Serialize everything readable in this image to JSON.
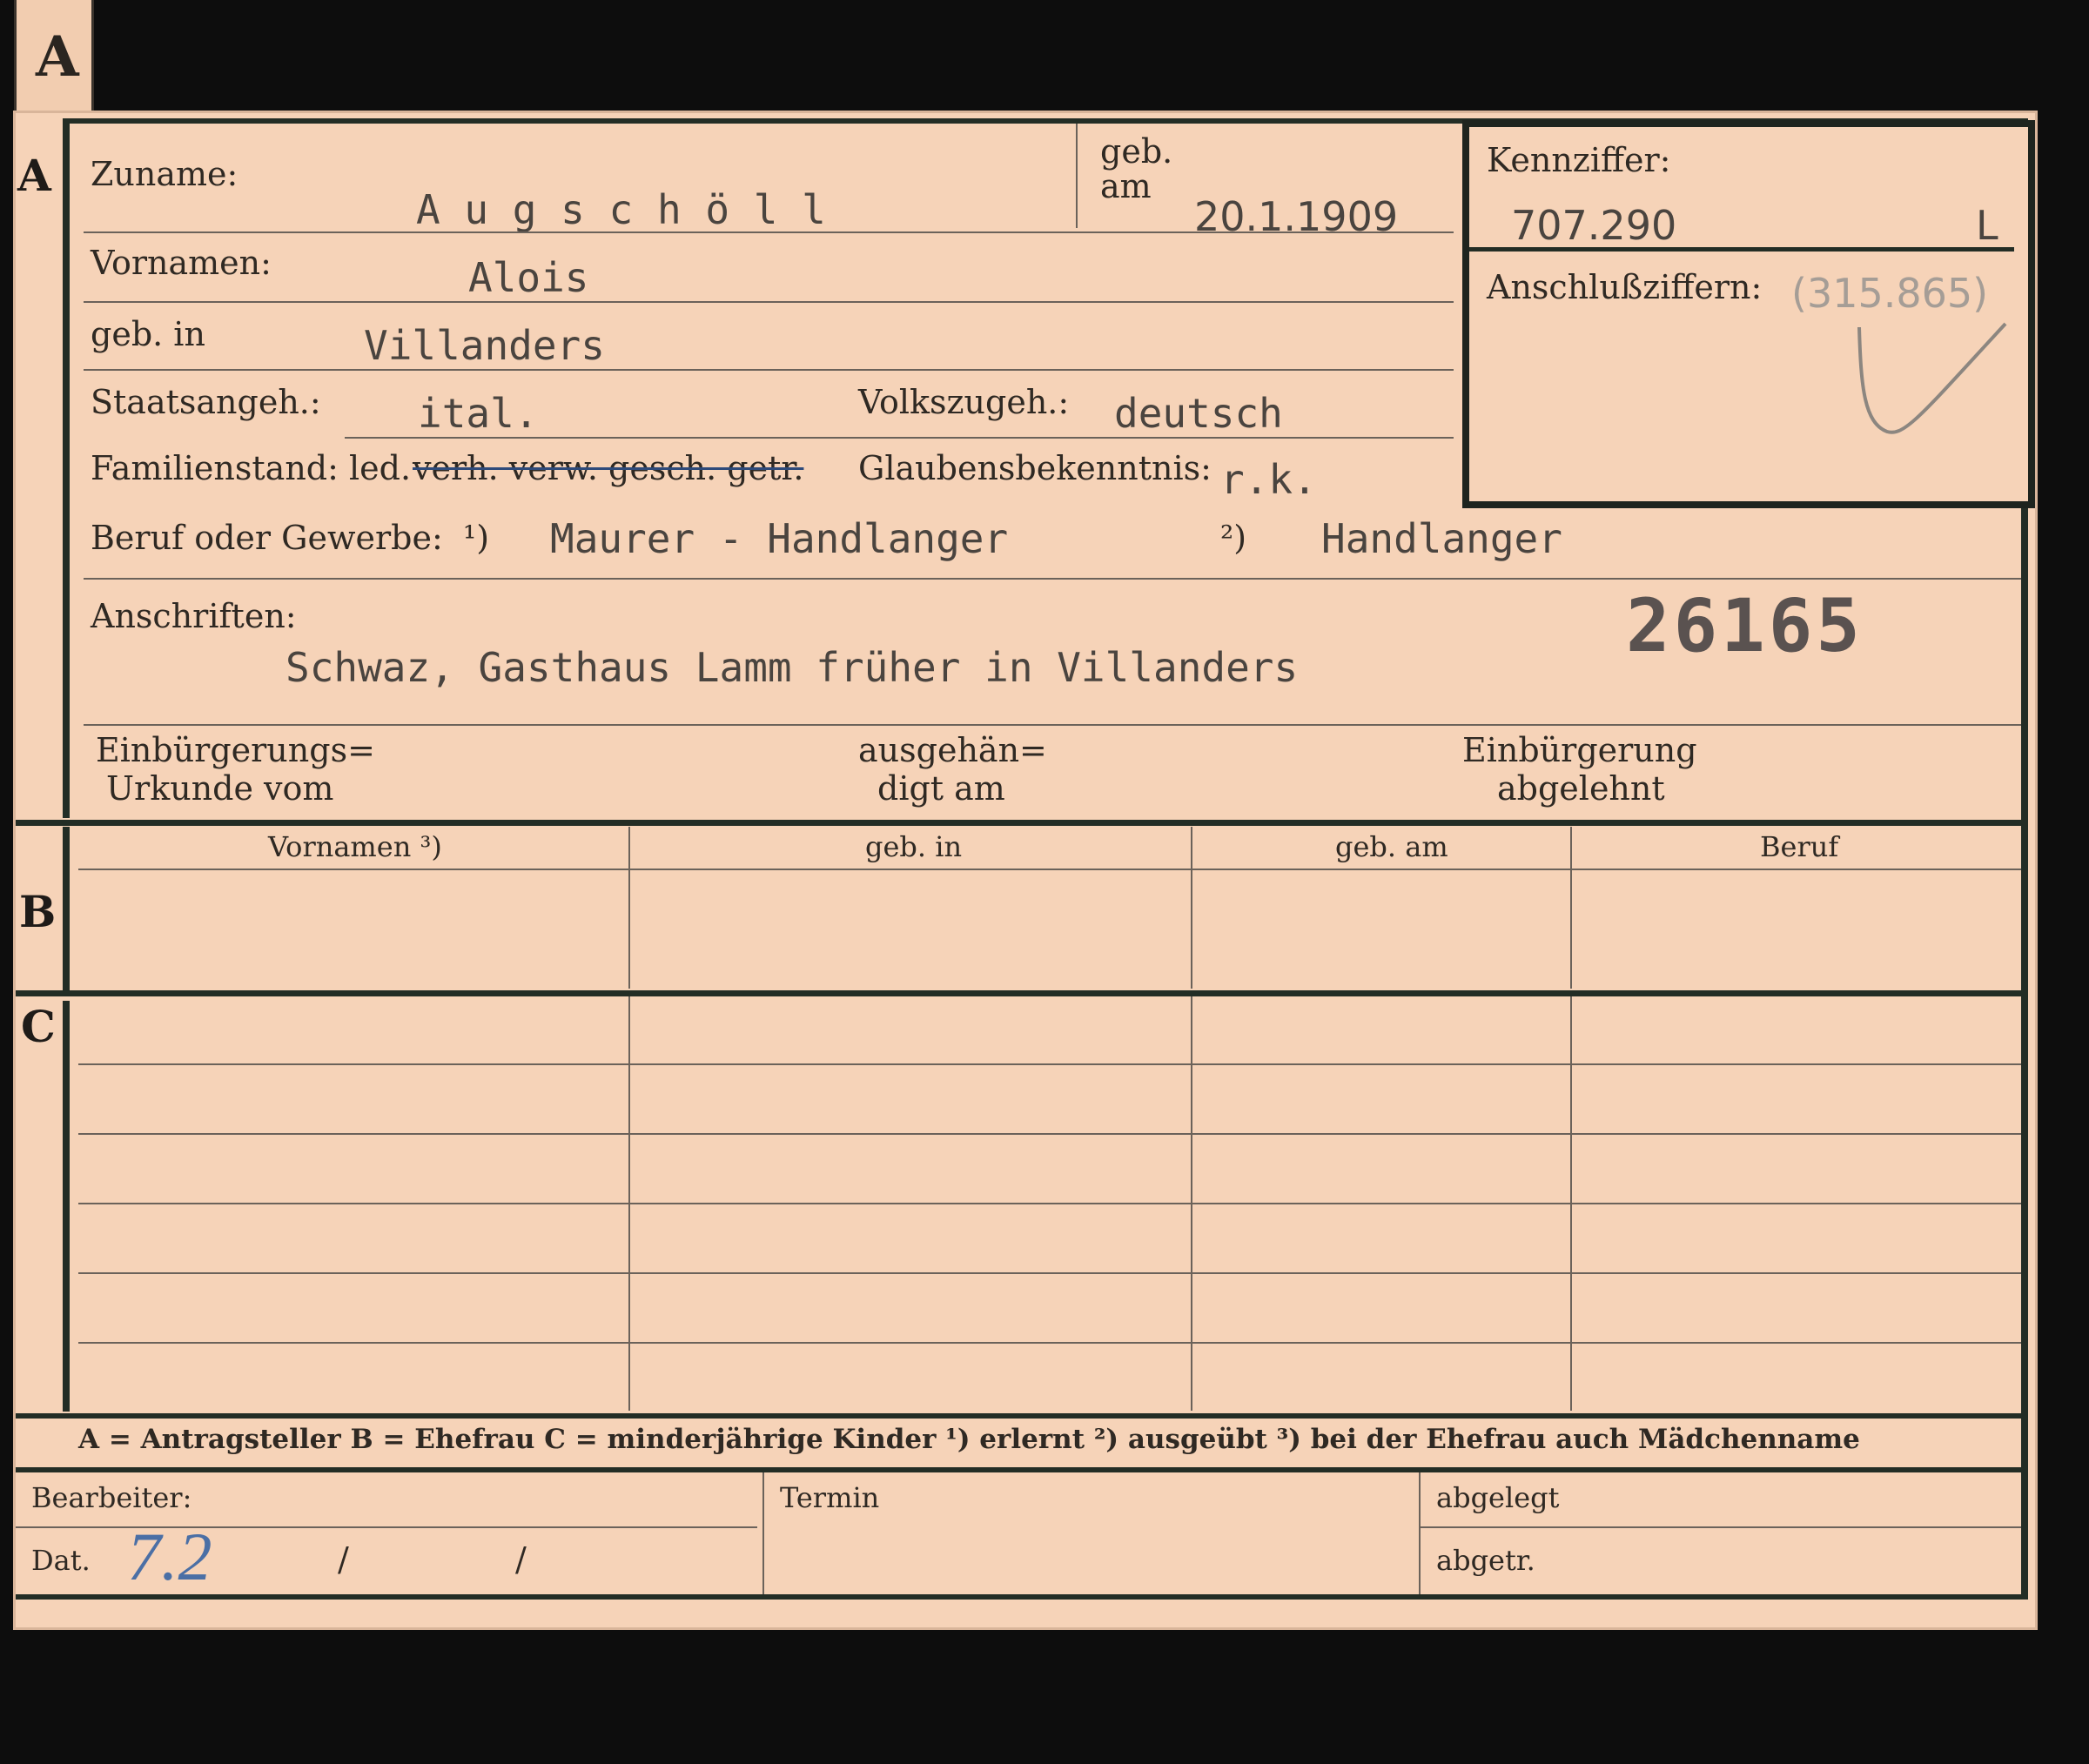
{
  "tab_letter": "A",
  "section_letters": {
    "a": "A",
    "b": "B",
    "c": "C"
  },
  "labels": {
    "zuname": "Zuname:",
    "geb_am_1": "geb.",
    "geb_am_2": "am",
    "kennziffer": "Kennziffer:",
    "anschluss": "Anschlußziffern:",
    "vornamen": "Vornamen:",
    "geb_in": "geb. in",
    "staatsangeh": "Staatsangeh.:",
    "volkszugeh": "Volkszugeh.:",
    "familienstand": "Familienstand: led.",
    "familienstand_struck": "verh. verw. gesch. getr.",
    "glaubens": "Glaubensbekenntnis:",
    "beruf": "Beruf oder Gewerbe:",
    "beruf_fn1": "¹)",
    "beruf_fn2": "²)",
    "anschriften": "Anschriften:",
    "einb_urk_1": "Einbürgerungs=",
    "einb_urk_2": "Urkunde vom",
    "ausgeh_1": "ausgehän=",
    "ausgeh_2": "digt am",
    "einb_abg_1": "Einbürgerung",
    "einb_abg_2": "abgelehnt",
    "col_vornamen": "Vornamen ³)",
    "col_geb_in": "geb. in",
    "col_geb_am": "geb. am",
    "col_beruf": "Beruf",
    "legend": "A = Antragsteller   B = Ehefrau   C = minderjährige Kinder   ¹) erlernt   ²) ausgeübt   ³) bei der Ehefrau auch Mädchenname",
    "bearbeiter": "Bearbeiter:",
    "termin": "Termin",
    "abgelegt": "abgelegt",
    "dat": "Dat.",
    "abgetr": "abgetr."
  },
  "values": {
    "zuname": "A u g s c h ö l l",
    "geb_am": "20.1.1909",
    "kennziffer": "707.290",
    "kennziffer_suffix": "L",
    "anschluss": "(315.865)",
    "vornamen": "Alois",
    "geb_in": "Villanders",
    "staatsangeh": "ital.",
    "volkszugeh": "deutsch",
    "glaubens": "r.k.",
    "beruf_1": "Maurer - Handlanger",
    "beruf_2": "Handlanger",
    "anschrift": "Schwaz, Gasthaus Lamm früher in Villanders",
    "stamp_number": "26165",
    "dat_hand": "7.2",
    "dat_sep1": "/",
    "dat_sep2": "/"
  }
}
